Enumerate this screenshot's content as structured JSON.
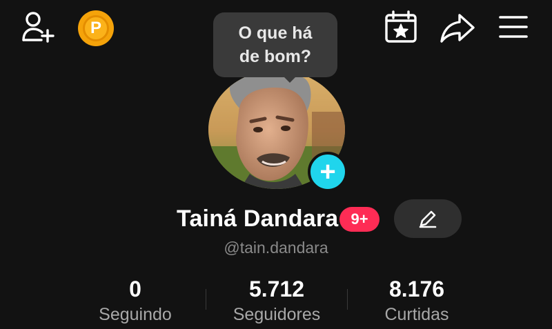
{
  "header": {
    "add_user_icon": "person-plus-icon",
    "coin_label": "P",
    "calendar_icon": "calendar-star-icon",
    "share_icon": "share-arrow-icon",
    "menu_icon": "hamburger-menu-icon"
  },
  "tooltip": {
    "text": "O que há de bom?"
  },
  "profile": {
    "name": "Tainá Dandara",
    "notification_badge": "9+",
    "username": "@tain.dandara",
    "edit_icon": "pencil-icon",
    "avatar_add_label": "+"
  },
  "stats": [
    {
      "value": "0",
      "label": "Seguindo"
    },
    {
      "value": "5.712",
      "label": "Seguidores"
    },
    {
      "value": "8.176",
      "label": "Curtidas"
    }
  ],
  "colors": {
    "background": "#121212",
    "badge": "#fe2c55",
    "avatar_add": "#20d5ec",
    "coin": "#fbb21a",
    "muted_text": "#8a8a8a"
  }
}
